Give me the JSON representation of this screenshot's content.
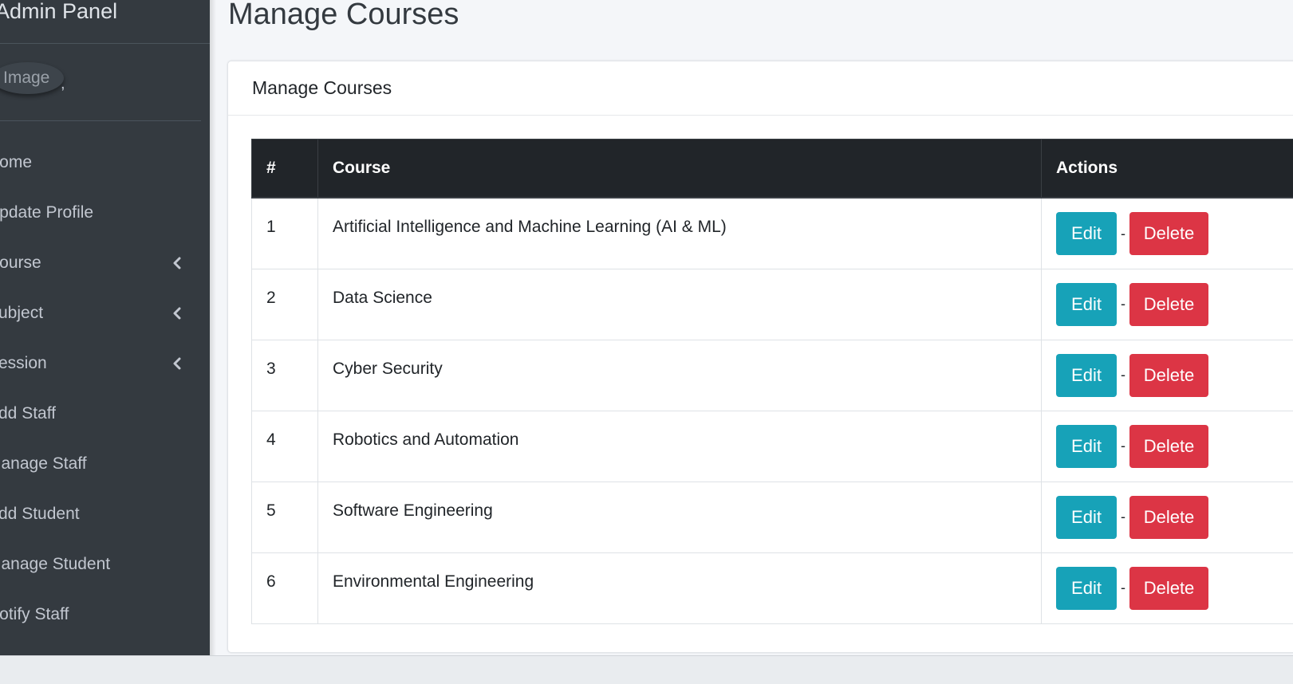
{
  "sidebar": {
    "brand": "Admin Panel",
    "user": {
      "avatar_alt": "Image",
      "name": ","
    },
    "items": [
      {
        "label": "Home",
        "expandable": false
      },
      {
        "label": "Update Profile",
        "expandable": false
      },
      {
        "label": "Course",
        "expandable": true
      },
      {
        "label": "Subject",
        "expandable": true
      },
      {
        "label": "Session",
        "expandable": true
      },
      {
        "label": "Add Staff",
        "expandable": false
      },
      {
        "label": "Manage Staff",
        "expandable": false
      },
      {
        "label": "Add Student",
        "expandable": false
      },
      {
        "label": "Manage Student",
        "expandable": false
      },
      {
        "label": "Notify Staff",
        "expandable": false
      }
    ]
  },
  "page": {
    "title": "Manage Courses"
  },
  "card": {
    "title": "Manage Courses"
  },
  "table": {
    "headers": [
      "#",
      "Course",
      "Actions"
    ],
    "rows": [
      {
        "num": "1",
        "course": "Artificial Intelligence and Machine Learning (AI & ML)"
      },
      {
        "num": "2",
        "course": "Data Science"
      },
      {
        "num": "3",
        "course": "Cyber Security"
      },
      {
        "num": "4",
        "course": "Robotics and Automation"
      },
      {
        "num": "5",
        "course": "Software Engineering"
      },
      {
        "num": "6",
        "course": "Environmental Engineering"
      }
    ],
    "edit_label": "Edit",
    "delete_label": "Delete",
    "separator": "-"
  },
  "colors": {
    "sidebar_bg": "#343a40",
    "table_header_bg": "#212529",
    "edit_button": "#17a2b8",
    "delete_button": "#dc3545"
  }
}
